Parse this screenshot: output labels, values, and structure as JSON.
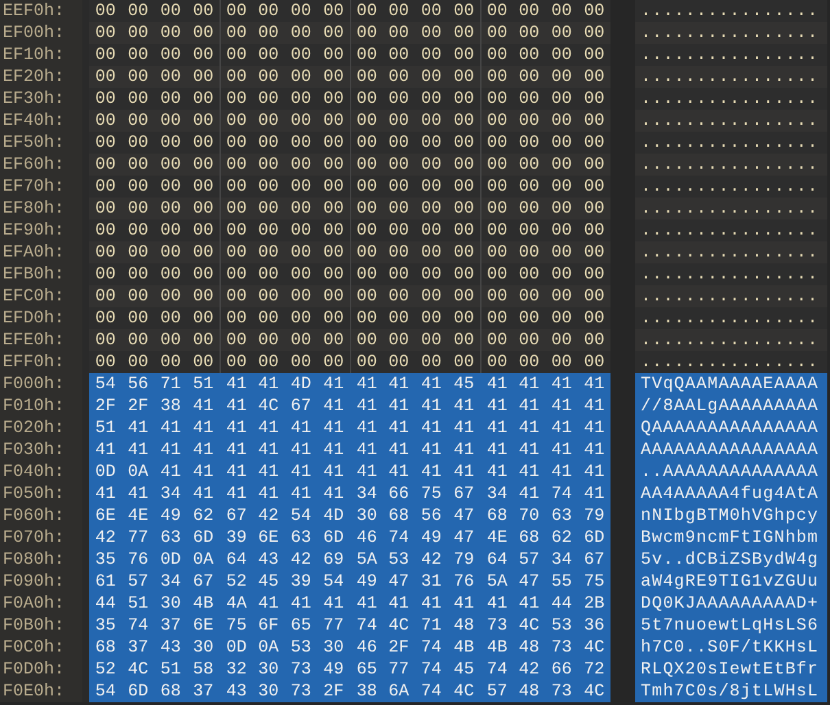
{
  "rows": [
    {
      "offset": "EEF0h:",
      "bytes": [
        "00",
        "00",
        "00",
        "00",
        "00",
        "00",
        "00",
        "00",
        "00",
        "00",
        "00",
        "00",
        "00",
        "00",
        "00",
        "00"
      ],
      "ascii": "................",
      "selected": false
    },
    {
      "offset": "EF00h:",
      "bytes": [
        "00",
        "00",
        "00",
        "00",
        "00",
        "00",
        "00",
        "00",
        "00",
        "00",
        "00",
        "00",
        "00",
        "00",
        "00",
        "00"
      ],
      "ascii": "................",
      "selected": false
    },
    {
      "offset": "EF10h:",
      "bytes": [
        "00",
        "00",
        "00",
        "00",
        "00",
        "00",
        "00",
        "00",
        "00",
        "00",
        "00",
        "00",
        "00",
        "00",
        "00",
        "00"
      ],
      "ascii": "................",
      "selected": false
    },
    {
      "offset": "EF20h:",
      "bytes": [
        "00",
        "00",
        "00",
        "00",
        "00",
        "00",
        "00",
        "00",
        "00",
        "00",
        "00",
        "00",
        "00",
        "00",
        "00",
        "00"
      ],
      "ascii": "................",
      "selected": false
    },
    {
      "offset": "EF30h:",
      "bytes": [
        "00",
        "00",
        "00",
        "00",
        "00",
        "00",
        "00",
        "00",
        "00",
        "00",
        "00",
        "00",
        "00",
        "00",
        "00",
        "00"
      ],
      "ascii": "................",
      "selected": false
    },
    {
      "offset": "EF40h:",
      "bytes": [
        "00",
        "00",
        "00",
        "00",
        "00",
        "00",
        "00",
        "00",
        "00",
        "00",
        "00",
        "00",
        "00",
        "00",
        "00",
        "00"
      ],
      "ascii": "................",
      "selected": false
    },
    {
      "offset": "EF50h:",
      "bytes": [
        "00",
        "00",
        "00",
        "00",
        "00",
        "00",
        "00",
        "00",
        "00",
        "00",
        "00",
        "00",
        "00",
        "00",
        "00",
        "00"
      ],
      "ascii": "................",
      "selected": false
    },
    {
      "offset": "EF60h:",
      "bytes": [
        "00",
        "00",
        "00",
        "00",
        "00",
        "00",
        "00",
        "00",
        "00",
        "00",
        "00",
        "00",
        "00",
        "00",
        "00",
        "00"
      ],
      "ascii": "................",
      "selected": false
    },
    {
      "offset": "EF70h:",
      "bytes": [
        "00",
        "00",
        "00",
        "00",
        "00",
        "00",
        "00",
        "00",
        "00",
        "00",
        "00",
        "00",
        "00",
        "00",
        "00",
        "00"
      ],
      "ascii": "................",
      "selected": false
    },
    {
      "offset": "EF80h:",
      "bytes": [
        "00",
        "00",
        "00",
        "00",
        "00",
        "00",
        "00",
        "00",
        "00",
        "00",
        "00",
        "00",
        "00",
        "00",
        "00",
        "00"
      ],
      "ascii": "................",
      "selected": false
    },
    {
      "offset": "EF90h:",
      "bytes": [
        "00",
        "00",
        "00",
        "00",
        "00",
        "00",
        "00",
        "00",
        "00",
        "00",
        "00",
        "00",
        "00",
        "00",
        "00",
        "00"
      ],
      "ascii": "................",
      "selected": false
    },
    {
      "offset": "EFA0h:",
      "bytes": [
        "00",
        "00",
        "00",
        "00",
        "00",
        "00",
        "00",
        "00",
        "00",
        "00",
        "00",
        "00",
        "00",
        "00",
        "00",
        "00"
      ],
      "ascii": "................",
      "selected": false
    },
    {
      "offset": "EFB0h:",
      "bytes": [
        "00",
        "00",
        "00",
        "00",
        "00",
        "00",
        "00",
        "00",
        "00",
        "00",
        "00",
        "00",
        "00",
        "00",
        "00",
        "00"
      ],
      "ascii": "................",
      "selected": false
    },
    {
      "offset": "EFC0h:",
      "bytes": [
        "00",
        "00",
        "00",
        "00",
        "00",
        "00",
        "00",
        "00",
        "00",
        "00",
        "00",
        "00",
        "00",
        "00",
        "00",
        "00"
      ],
      "ascii": "................",
      "selected": false
    },
    {
      "offset": "EFD0h:",
      "bytes": [
        "00",
        "00",
        "00",
        "00",
        "00",
        "00",
        "00",
        "00",
        "00",
        "00",
        "00",
        "00",
        "00",
        "00",
        "00",
        "00"
      ],
      "ascii": "................",
      "selected": false
    },
    {
      "offset": "EFE0h:",
      "bytes": [
        "00",
        "00",
        "00",
        "00",
        "00",
        "00",
        "00",
        "00",
        "00",
        "00",
        "00",
        "00",
        "00",
        "00",
        "00",
        "00"
      ],
      "ascii": "................",
      "selected": false
    },
    {
      "offset": "EFF0h:",
      "bytes": [
        "00",
        "00",
        "00",
        "00",
        "00",
        "00",
        "00",
        "00",
        "00",
        "00",
        "00",
        "00",
        "00",
        "00",
        "00",
        "00"
      ],
      "ascii": "................",
      "selected": false
    },
    {
      "offset": "F000h:",
      "bytes": [
        "54",
        "56",
        "71",
        "51",
        "41",
        "41",
        "4D",
        "41",
        "41",
        "41",
        "41",
        "45",
        "41",
        "41",
        "41",
        "41"
      ],
      "ascii": "TVqQAAMAAAAEAAAA",
      "selected": true
    },
    {
      "offset": "F010h:",
      "bytes": [
        "2F",
        "2F",
        "38",
        "41",
        "41",
        "4C",
        "67",
        "41",
        "41",
        "41",
        "41",
        "41",
        "41",
        "41",
        "41",
        "41"
      ],
      "ascii": "//8AALgAAAAAAAAA",
      "selected": true
    },
    {
      "offset": "F020h:",
      "bytes": [
        "51",
        "41",
        "41",
        "41",
        "41",
        "41",
        "41",
        "41",
        "41",
        "41",
        "41",
        "41",
        "41",
        "41",
        "41",
        "41"
      ],
      "ascii": "QAAAAAAAAAAAAAAA",
      "selected": true
    },
    {
      "offset": "F030h:",
      "bytes": [
        "41",
        "41",
        "41",
        "41",
        "41",
        "41",
        "41",
        "41",
        "41",
        "41",
        "41",
        "41",
        "41",
        "41",
        "41",
        "41"
      ],
      "ascii": "AAAAAAAAAAAAAAAA",
      "selected": true
    },
    {
      "offset": "F040h:",
      "bytes": [
        "0D",
        "0A",
        "41",
        "41",
        "41",
        "41",
        "41",
        "41",
        "41",
        "41",
        "41",
        "41",
        "41",
        "41",
        "41",
        "41"
      ],
      "ascii": "..AAAAAAAAAAAAAA",
      "selected": true
    },
    {
      "offset": "F050h:",
      "bytes": [
        "41",
        "41",
        "34",
        "41",
        "41",
        "41",
        "41",
        "41",
        "34",
        "66",
        "75",
        "67",
        "34",
        "41",
        "74",
        "41"
      ],
      "ascii": "AA4AAAAA4fug4AtA",
      "selected": true
    },
    {
      "offset": "F060h:",
      "bytes": [
        "6E",
        "4E",
        "49",
        "62",
        "67",
        "42",
        "54",
        "4D",
        "30",
        "68",
        "56",
        "47",
        "68",
        "70",
        "63",
        "79"
      ],
      "ascii": "nNIbgBTM0hVGhpcy",
      "selected": true
    },
    {
      "offset": "F070h:",
      "bytes": [
        "42",
        "77",
        "63",
        "6D",
        "39",
        "6E",
        "63",
        "6D",
        "46",
        "74",
        "49",
        "47",
        "4E",
        "68",
        "62",
        "6D"
      ],
      "ascii": "Bwcm9ncmFtIGNhbm",
      "selected": true
    },
    {
      "offset": "F080h:",
      "bytes": [
        "35",
        "76",
        "0D",
        "0A",
        "64",
        "43",
        "42",
        "69",
        "5A",
        "53",
        "42",
        "79",
        "64",
        "57",
        "34",
        "67"
      ],
      "ascii": "5v..dCBiZSBydW4g",
      "selected": true
    },
    {
      "offset": "F090h:",
      "bytes": [
        "61",
        "57",
        "34",
        "67",
        "52",
        "45",
        "39",
        "54",
        "49",
        "47",
        "31",
        "76",
        "5A",
        "47",
        "55",
        "75"
      ],
      "ascii": "aW4gRE9TIG1vZGUu",
      "selected": true
    },
    {
      "offset": "F0A0h:",
      "bytes": [
        "44",
        "51",
        "30",
        "4B",
        "4A",
        "41",
        "41",
        "41",
        "41",
        "41",
        "41",
        "41",
        "41",
        "41",
        "44",
        "2B"
      ],
      "ascii": "DQ0KJAAAAAAAAAD+",
      "selected": true
    },
    {
      "offset": "F0B0h:",
      "bytes": [
        "35",
        "74",
        "37",
        "6E",
        "75",
        "6F",
        "65",
        "77",
        "74",
        "4C",
        "71",
        "48",
        "73",
        "4C",
        "53",
        "36"
      ],
      "ascii": "5t7nuoewtLqHsLS6",
      "selected": true
    },
    {
      "offset": "F0C0h:",
      "bytes": [
        "68",
        "37",
        "43",
        "30",
        "0D",
        "0A",
        "53",
        "30",
        "46",
        "2F",
        "74",
        "4B",
        "4B",
        "48",
        "73",
        "4C"
      ],
      "ascii": "h7C0..S0F/tKKHsL",
      "selected": true
    },
    {
      "offset": "F0D0h:",
      "bytes": [
        "52",
        "4C",
        "51",
        "58",
        "32",
        "30",
        "73",
        "49",
        "65",
        "77",
        "74",
        "45",
        "74",
        "42",
        "66",
        "72"
      ],
      "ascii": "RLQX20sIewtEtBfr",
      "selected": true
    },
    {
      "offset": "F0E0h:",
      "bytes": [
        "54",
        "6D",
        "68",
        "37",
        "43",
        "30",
        "73",
        "2F",
        "38",
        "6A",
        "74",
        "4C",
        "57",
        "48",
        "73",
        "4C"
      ],
      "ascii": "Tmh7C0s/8jtLWHsL",
      "selected": true
    }
  ]
}
